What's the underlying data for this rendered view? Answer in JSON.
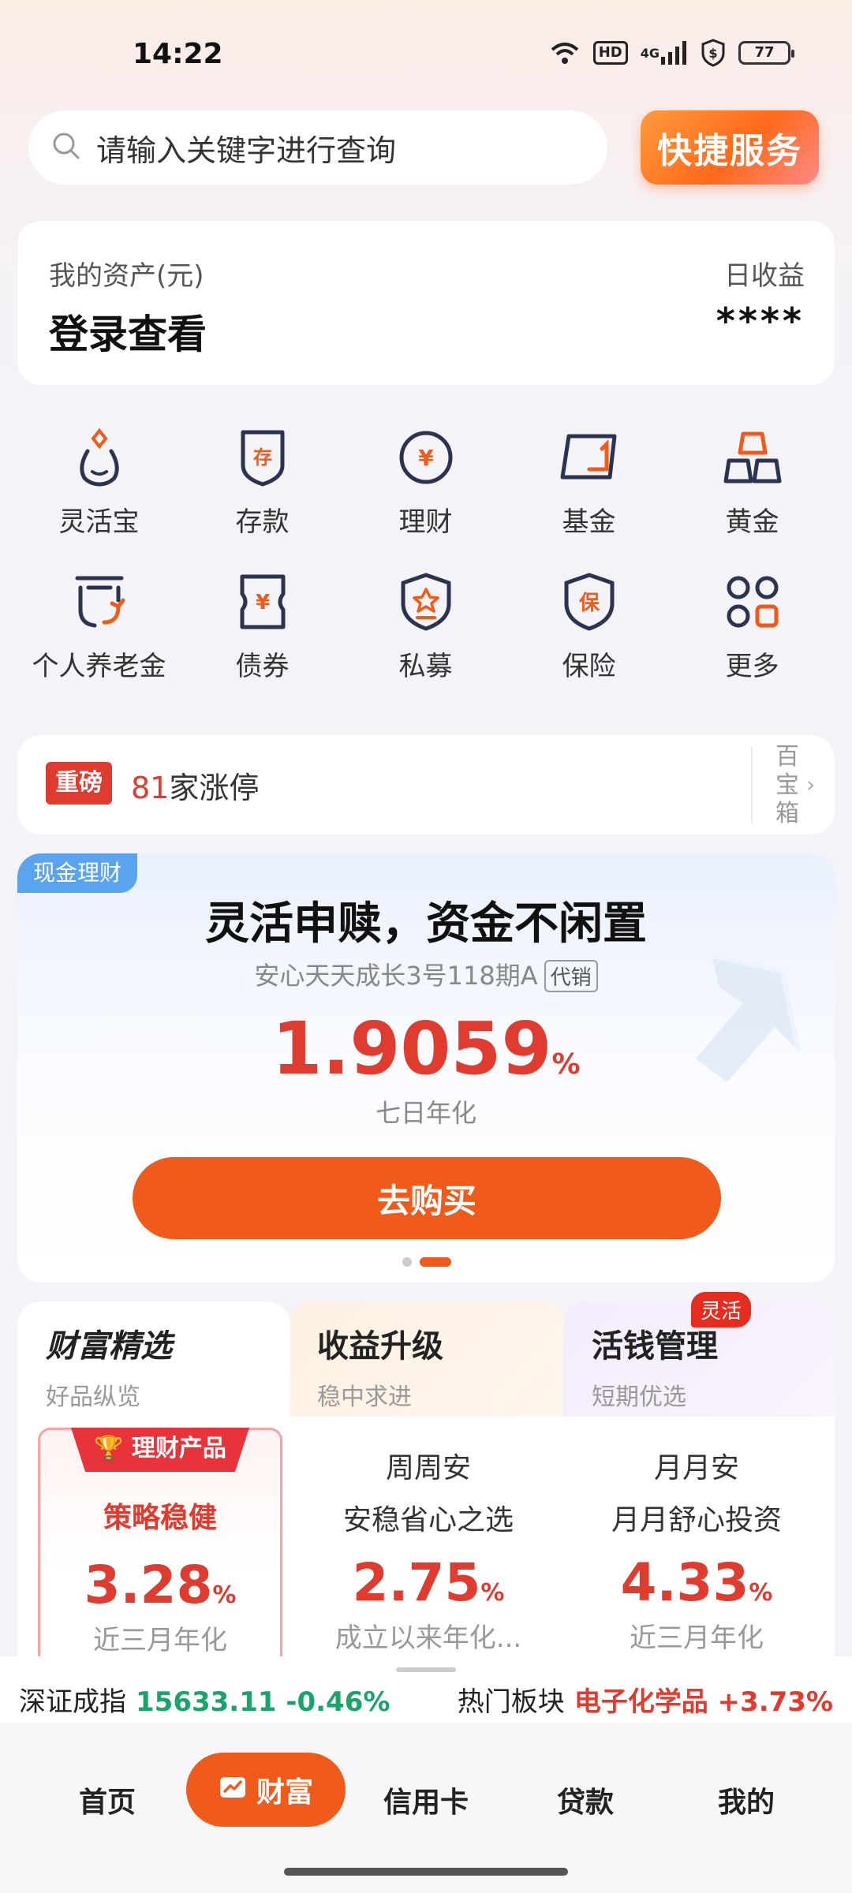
{
  "status_bar": {
    "time": "14:22",
    "hd": "HD",
    "network": "4G",
    "battery": "77"
  },
  "search": {
    "placeholder": "请输入关键字进行查询"
  },
  "quick_service": "快捷服务",
  "assets": {
    "label": "我的资产(元)",
    "login": "登录查看",
    "daily_label": "日收益",
    "daily_value": "****"
  },
  "grid": [
    {
      "label": "灵活宝",
      "icon": "lingbao-icon"
    },
    {
      "label": "存款",
      "icon": "deposit-icon",
      "glyph": "存"
    },
    {
      "label": "理财",
      "icon": "finance-icon",
      "glyph": "¥"
    },
    {
      "label": "基金",
      "icon": "fund-icon"
    },
    {
      "label": "黄金",
      "icon": "gold-icon"
    },
    {
      "label": "个人养老金",
      "icon": "pension-icon"
    },
    {
      "label": "债券",
      "icon": "bond-icon",
      "glyph": "¥"
    },
    {
      "label": "私募",
      "icon": "private-fund-icon"
    },
    {
      "label": "保险",
      "icon": "insurance-icon",
      "glyph": "保"
    },
    {
      "label": "更多",
      "icon": "more-icon"
    }
  ],
  "news": {
    "tag": "重磅",
    "count": "81",
    "text": "家涨停",
    "box_label": "百宝箱"
  },
  "promo": {
    "tag": "现金理财",
    "title": "灵活申赎，资金不闲置",
    "product": "安心天天成长3号118期A",
    "product_tag": "代销",
    "rate": "1.9059",
    "rate_unit": "%",
    "rate_label": "七日年化",
    "button": "去购买"
  },
  "tabs": [
    {
      "title": "财富精选",
      "sub": "好品纵览"
    },
    {
      "title": "收益升级",
      "sub": "稳中求进"
    },
    {
      "title": "活钱管理",
      "sub": "短期优选",
      "badge": "灵活"
    }
  ],
  "products": [
    {
      "ribbon": "理财产品",
      "name": "策略稳健",
      "rate": "3.28",
      "unit": "%",
      "rate_label": "近三月年化"
    },
    {
      "name": "周周安",
      "desc": "安稳省心之选",
      "rate": "2.75",
      "unit": "%",
      "rate_label": "成立以来年化..."
    },
    {
      "name": "月月安",
      "desc": "月月舒心投资",
      "rate": "4.33",
      "unit": "%",
      "rate_label": "近三月年化"
    }
  ],
  "ticker": {
    "index_name": "深证成指",
    "index_value": "15633.11 -0.46%",
    "sector_label": "热门板块",
    "sector_value": "电子化学品 +3.73%"
  },
  "nav": {
    "home": "首页",
    "wealth": "财富",
    "credit": "信用卡",
    "loan": "贷款",
    "mine": "我的"
  },
  "colors": {
    "accent": "#f05a1a",
    "red": "#e03b2f",
    "green": "#1aa36b",
    "navy": "#2b3350"
  }
}
